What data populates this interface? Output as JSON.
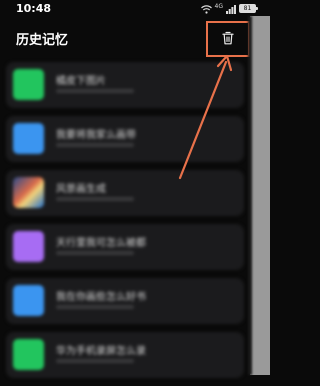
{
  "status_bar": {
    "time": "10:48",
    "network": "4G",
    "battery": "81"
  },
  "header": {
    "title": "历史记忆",
    "delete_icon": "trash-icon"
  },
  "history": [
    {
      "title": "橘皮下图片",
      "thumb": "green"
    },
    {
      "title": "我要将我家么画带",
      "thumb": "blue"
    },
    {
      "title": "风景画生成",
      "thumb": "photo"
    },
    {
      "title": "天行里我可怎么被都",
      "thumb": "purple"
    },
    {
      "title": "我在你画些怎么好书",
      "thumb": "blue"
    },
    {
      "title": "华为手机录屏怎么录",
      "thumb": "green"
    }
  ],
  "colors": {
    "highlight": "#e8714a",
    "background": "#0a0a0a"
  }
}
